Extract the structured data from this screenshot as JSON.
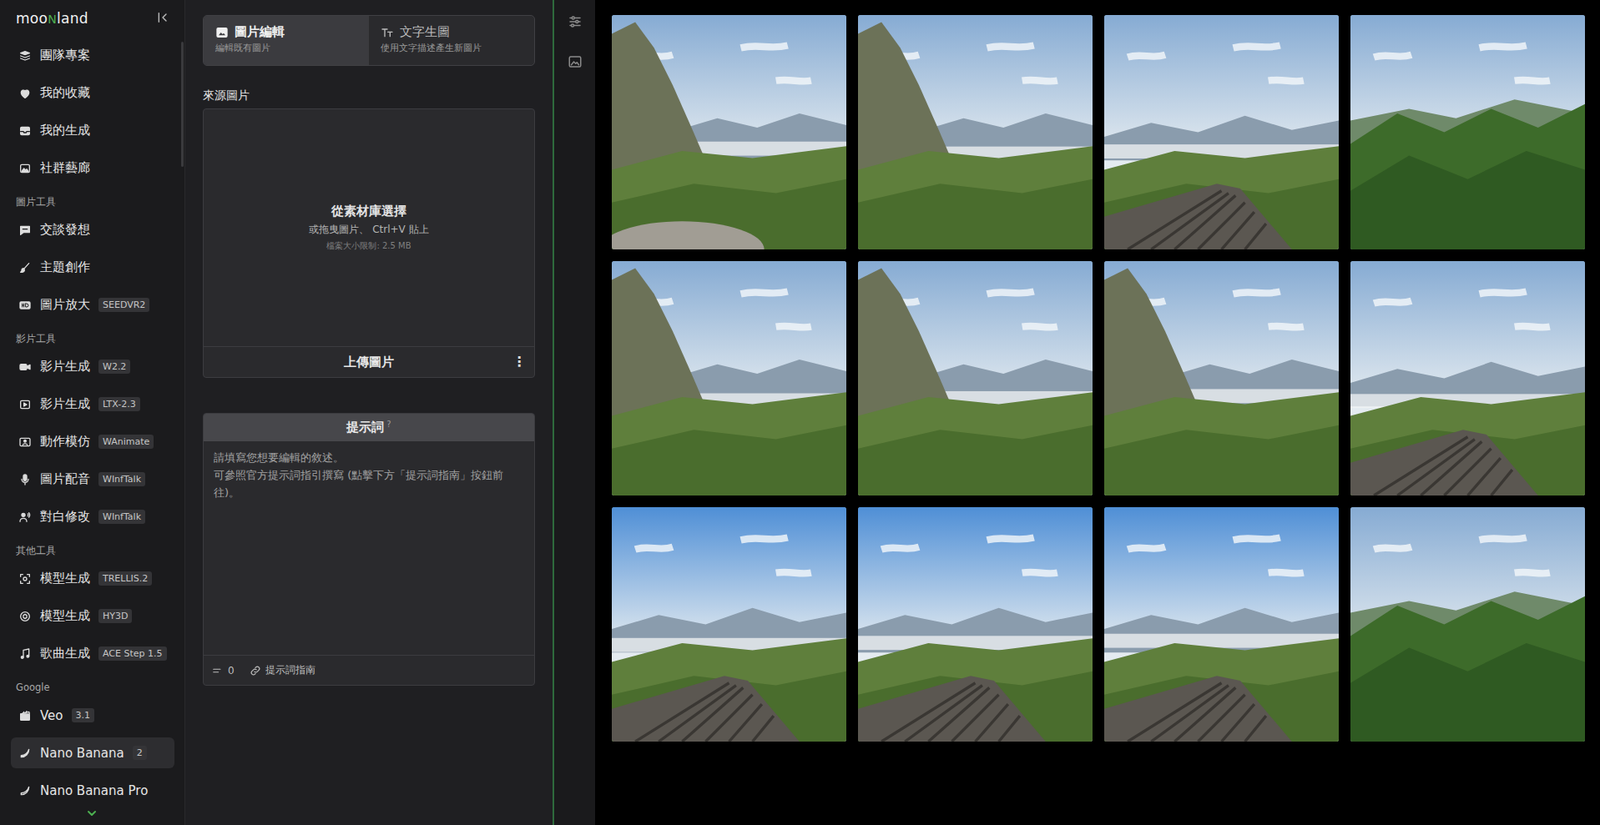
{
  "logo": {
    "parts": [
      {
        "text": "moo",
        "accent": false
      },
      {
        "text": "N",
        "accent": true
      },
      {
        "text": "land",
        "accent": false
      }
    ]
  },
  "sidebar": {
    "top_items": [
      {
        "label": "團隊專案",
        "badge": "",
        "selected": false
      },
      {
        "label": "我的收藏",
        "badge": "",
        "selected": false
      },
      {
        "label": "我的生成",
        "badge": "",
        "selected": false
      },
      {
        "label": "社群藝廊",
        "badge": "",
        "selected": false
      }
    ],
    "sections": [
      {
        "title": "圖片工具",
        "items": [
          {
            "label": "交談發想",
            "badge": "",
            "selected": false
          },
          {
            "label": "主題創作",
            "badge": "",
            "selected": false
          },
          {
            "label": "圖片放大",
            "badge": "SEEDVR2",
            "selected": false
          }
        ]
      },
      {
        "title": "影片工具",
        "items": [
          {
            "label": "影片生成",
            "badge": "W2.2",
            "selected": false
          },
          {
            "label": "影片生成",
            "badge": "LTX-2.3",
            "selected": false
          },
          {
            "label": "動作模仿",
            "badge": "WAnimate",
            "selected": false
          },
          {
            "label": "圖片配音",
            "badge": "WInfTalk",
            "selected": false
          },
          {
            "label": "對白修改",
            "badge": "WInfTalk",
            "selected": false
          }
        ]
      },
      {
        "title": "其他工具",
        "items": [
          {
            "label": "模型生成",
            "badge": "TRELLIS.2",
            "selected": false
          },
          {
            "label": "模型生成",
            "badge": "HY3D",
            "selected": false
          },
          {
            "label": "歌曲生成",
            "badge": "ACE Step 1.5",
            "selected": false
          }
        ]
      },
      {
        "title": "Google",
        "items": [
          {
            "label": "Veo",
            "badge": "3.1",
            "selected": false
          },
          {
            "label": "Nano Banana",
            "badge": "2",
            "selected": true
          },
          {
            "label": "Nano Banana Pro",
            "badge": "",
            "selected": false
          }
        ]
      }
    ]
  },
  "tabs": [
    {
      "label": "圖片編輯",
      "subtitle": "編輯既有圖片",
      "selected": true
    },
    {
      "label": "文字生圖",
      "subtitle": "使用文字描述產生新圖片",
      "selected": false
    }
  ],
  "upload": {
    "label": "來源圖片",
    "title": "從素材庫選擇",
    "hint": "或拖曳圖片、 Ctrl+V 貼上",
    "limit": "檔案大小限制: 2.5 MB",
    "button": "上傳圖片",
    "menu": "⋮"
  },
  "prompt": {
    "title": "提示詞",
    "help": "?",
    "placeholder": "請填寫您想要編輯的敘述。\n可參照官方提示詞指引撰寫 (點擊下方「提示詞指南」按鈕前往)。",
    "count": "0",
    "guide": "提示詞指南"
  },
  "gallery": {
    "images": [
      {
        "kind": "valley"
      },
      {
        "kind": "valley"
      },
      {
        "kind": "roof"
      },
      {
        "kind": "forest"
      },
      {
        "kind": "valley"
      },
      {
        "kind": "valley"
      },
      {
        "kind": "valley"
      },
      {
        "kind": "roof"
      },
      {
        "kind": "roof"
      },
      {
        "kind": "roof"
      },
      {
        "kind": "roof"
      },
      {
        "kind": "forest"
      }
    ]
  }
}
